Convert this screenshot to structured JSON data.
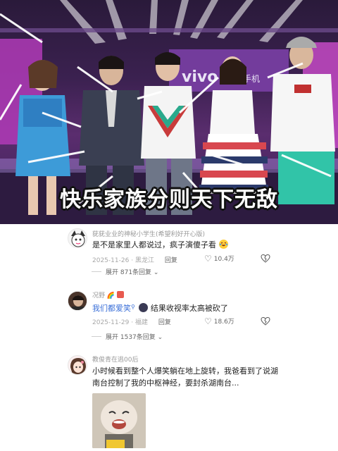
{
  "video": {
    "caption": "快乐家族分则天下无敌",
    "stage_logo": "vivo",
    "stage_logo_tail": "手机"
  },
  "comments": [
    {
      "username": "莸莸业业的神秘小学生(希望利好开心版)",
      "text": "是不是家里人都说过，疯子演傻子看",
      "emoji": "laughing-crying-emoji",
      "date": "2025-11-26",
      "location": "黑龙江",
      "reply_label": "回复",
      "likes": "10.4万",
      "expand_label": "展开 871条回复"
    },
    {
      "username": "况野",
      "text_prefix": "我们都爱笑",
      "text_suffix": "结果收视率太高被砍了",
      "date": "2025-11-29",
      "location": "福建",
      "reply_label": "回复",
      "likes": "18.6万",
      "expand_label": "展开 1537条回复"
    },
    {
      "username": "教俊青在逃00后",
      "text": "小时候看到整个人爆笑躺在地上旋转，我爸看到了说湖南台控制了我的中枢神经，要封杀湖南台...",
      "date": "",
      "location": ""
    }
  ],
  "colors": {
    "accent_link": "#3a6fd8",
    "meta_gray": "#a8a8a8",
    "caption_fill": "#ffffff",
    "caption_stroke": "#111111"
  }
}
